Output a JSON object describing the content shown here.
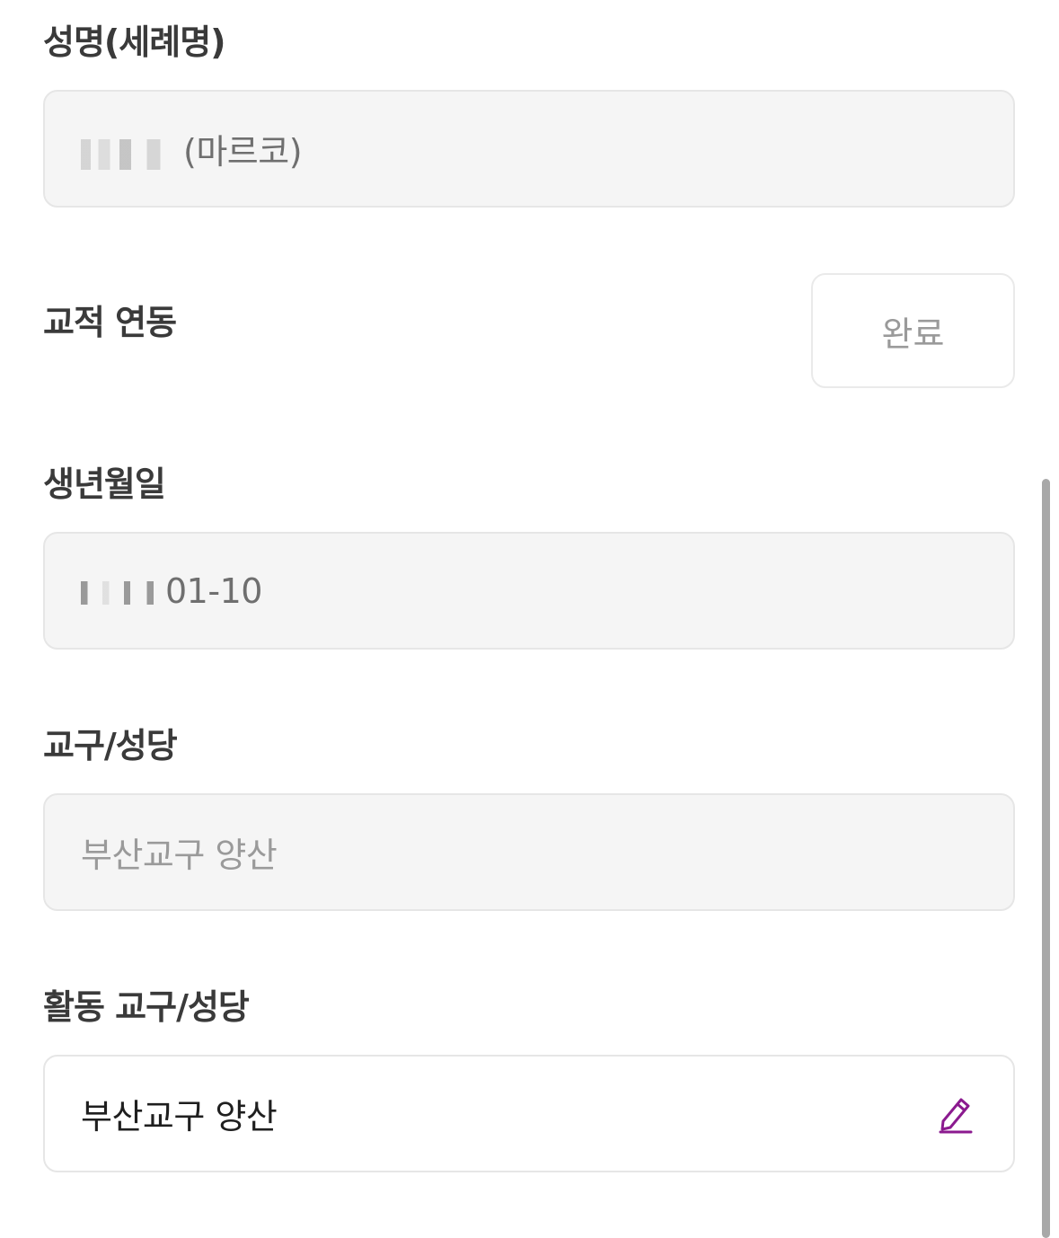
{
  "sections": {
    "name": {
      "label": "성명(세례명)",
      "value": "(마르코)"
    },
    "parish_link": {
      "label": "교적 연동",
      "button": "완료"
    },
    "birth": {
      "label": "생년월일",
      "value": "01-10"
    },
    "diocese": {
      "label": "교구/성당",
      "value": "부산교구 양산"
    },
    "active_diocese": {
      "label": "활동 교구/성당",
      "value": "부산교구 양산",
      "edit_icon": "pencil-icon"
    }
  },
  "colors": {
    "accent": "#8b1a8f",
    "field_bg": "#f5f5f5",
    "border": "#e6e6e6"
  }
}
